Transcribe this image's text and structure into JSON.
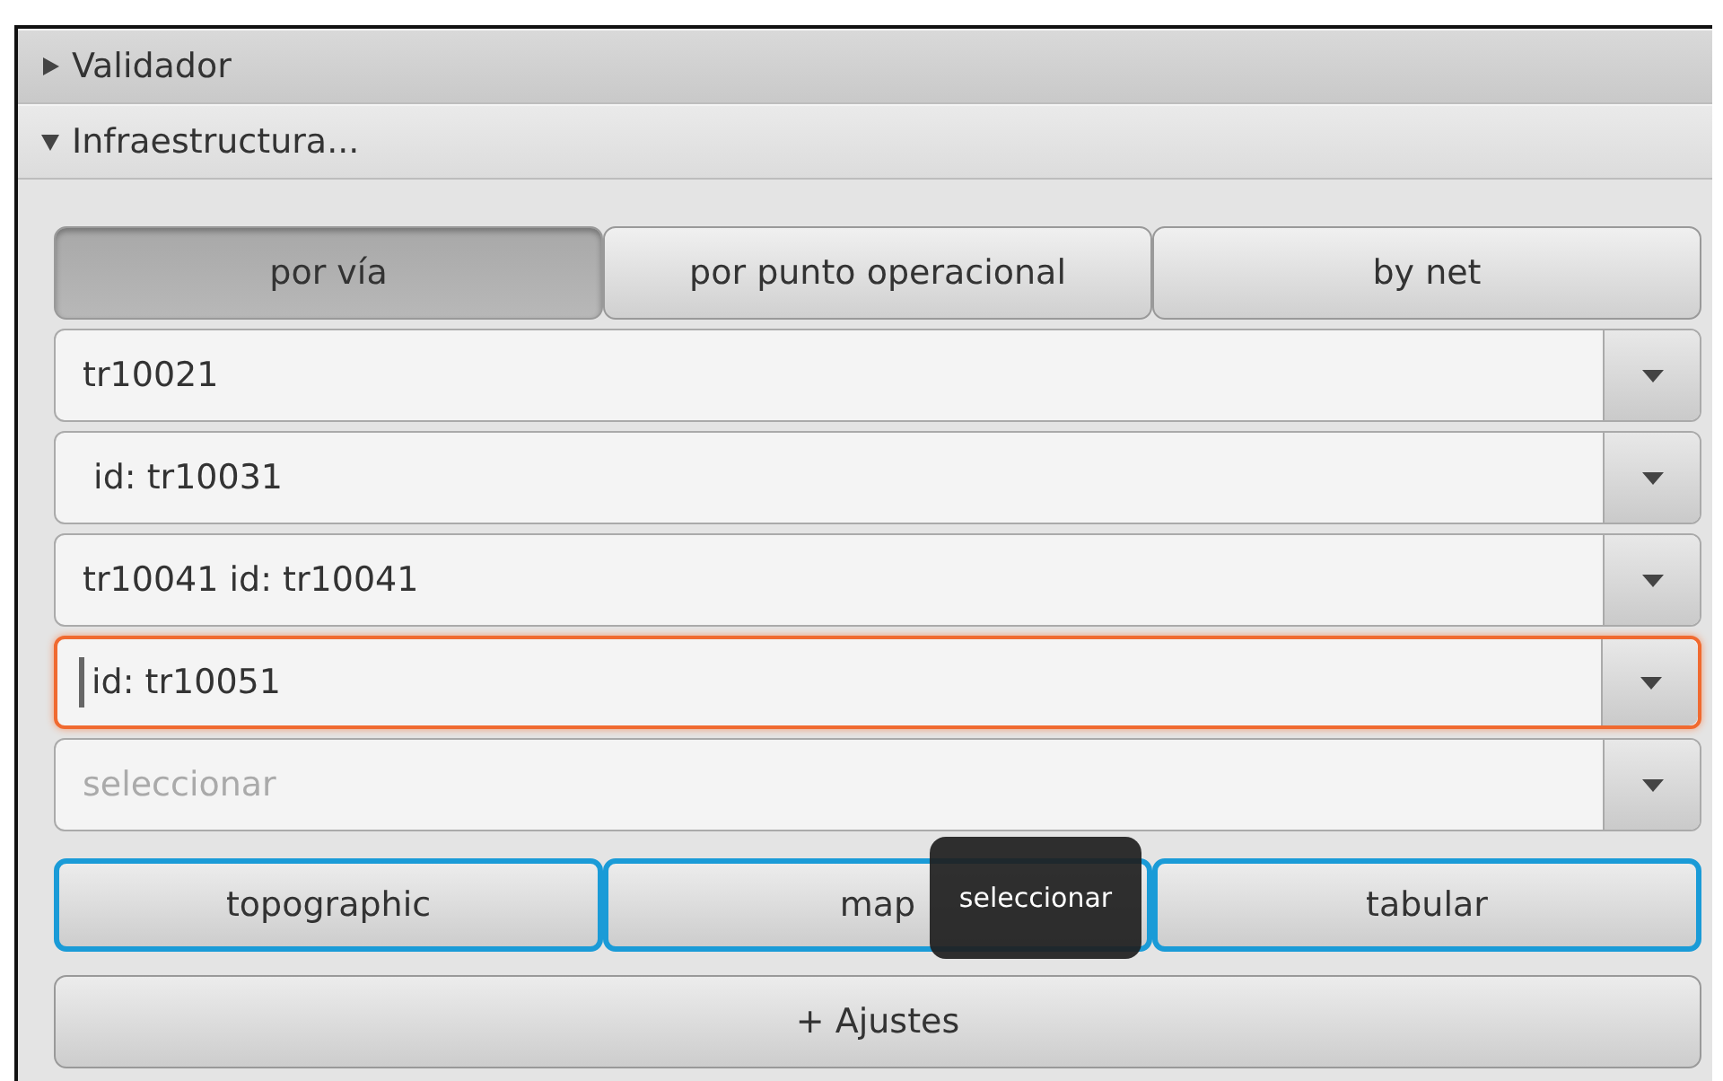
{
  "sections": [
    {
      "title": "Validador",
      "expanded": false
    },
    {
      "title": "Infraestructura...",
      "expanded": true
    }
  ],
  "segments": [
    {
      "label": "por vía",
      "selected": true
    },
    {
      "label": "por punto operacional",
      "selected": false
    },
    {
      "label": "by net",
      "selected": false
    }
  ],
  "combos": [
    {
      "value": "tr10021",
      "focused": false
    },
    {
      "value": " id: tr10031",
      "focused": false
    },
    {
      "value": "tr10041 id: tr10041",
      "focused": false
    },
    {
      "value": "id: tr10051",
      "focused": true
    },
    {
      "placeholder": "seleccionar",
      "focused": false
    }
  ],
  "views": [
    {
      "label": "topographic",
      "highlighted": true
    },
    {
      "label": "map",
      "highlighted": true
    },
    {
      "label": "tabular",
      "highlighted": true
    }
  ],
  "tooltip": "seleccionar",
  "settings_button": "+ Ajustes"
}
